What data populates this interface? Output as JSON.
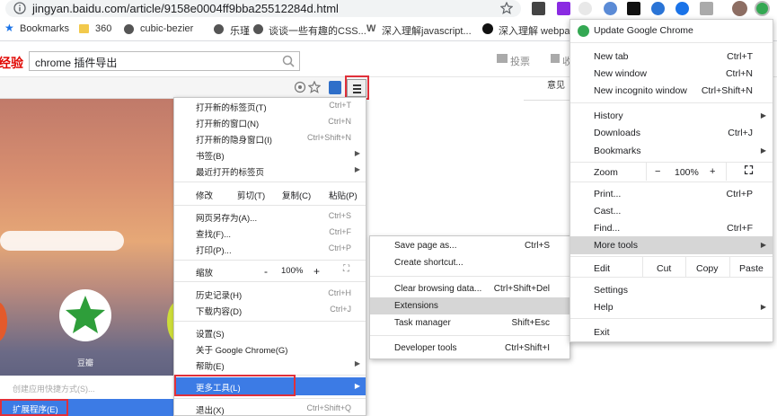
{
  "url": "jingyan.baidu.com/article/9158e0004ff9bba25512284d.html",
  "bookmarks": [
    {
      "label": "Bookmarks"
    },
    {
      "label": "360"
    },
    {
      "label": "cubic-bezier"
    },
    {
      "label": "乐瑾"
    },
    {
      "label": "谈谈一些有趣的CSS..."
    },
    {
      "label": "深入理解javascript..."
    },
    {
      "label": "深入理解 webpac"
    }
  ],
  "baidu": {
    "logo": "经验",
    "search_value": "chrome 插件导出",
    "vote": "投票",
    "close": "收",
    "feedback": "意见"
  },
  "newtab": {
    "tile_label": "豆瓣",
    "create_shortcut": "创建应用快捷方式(S)...",
    "extensions": "扩展程序(E)"
  },
  "cmenu": {
    "items": [
      {
        "label": "打开新的标签页(T)",
        "shortcut": "Ctrl+T"
      },
      {
        "label": "打开新的窗口(N)",
        "shortcut": "Ctrl+N"
      },
      {
        "label": "打开新的隐身窗口(I)",
        "shortcut": "Ctrl+Shift+N"
      },
      {
        "label": "书签(B)",
        "shortcut": ""
      },
      {
        "label": "最近打开的标签页",
        "shortcut": ""
      }
    ],
    "edit": {
      "label": "修改",
      "cut": "剪切(T)",
      "copy": "复制(C)",
      "paste": "粘贴(P)"
    },
    "items2": [
      {
        "label": "网页另存为(A)...",
        "shortcut": "Ctrl+S"
      },
      {
        "label": "查找(F)...",
        "shortcut": "Ctrl+F"
      },
      {
        "label": "打印(P)...",
        "shortcut": "Ctrl+P"
      }
    ],
    "zoom": {
      "label": "缩放",
      "minus": "-",
      "value": "100%",
      "plus": "+"
    },
    "items3": [
      {
        "label": "历史记录(H)",
        "shortcut": "Ctrl+H"
      },
      {
        "label": "下载内容(D)",
        "shortcut": "Ctrl+J"
      }
    ],
    "items4": [
      {
        "label": "设置(S)"
      },
      {
        "label": "关于 Google Chrome(G)"
      },
      {
        "label": "帮助(E)"
      }
    ],
    "more_tools": "更多工具(L)",
    "exit": {
      "label": "退出(X)",
      "shortcut": "Ctrl+Shift+Q"
    }
  },
  "csub": {
    "items": [
      {
        "label": "Save page as...",
        "shortcut": "Ctrl+S"
      },
      {
        "label": "Create shortcut...",
        "shortcut": ""
      },
      {
        "label": "Clear browsing data...",
        "shortcut": "Ctrl+Shift+Del"
      },
      {
        "label": "Extensions",
        "shortcut": ""
      },
      {
        "label": "Task manager",
        "shortcut": "Shift+Esc"
      },
      {
        "label": "Developer tools",
        "shortcut": "Ctrl+Shift+I"
      }
    ]
  },
  "mmenu": {
    "update": "Update Google Chrome",
    "items1": [
      {
        "label": "New tab",
        "shortcut": "Ctrl+T"
      },
      {
        "label": "New window",
        "shortcut": "Ctrl+N"
      },
      {
        "label": "New incognito window",
        "shortcut": "Ctrl+Shift+N"
      }
    ],
    "items2": [
      {
        "label": "History",
        "shortcut": ""
      },
      {
        "label": "Downloads",
        "shortcut": "Ctrl+J"
      },
      {
        "label": "Bookmarks",
        "shortcut": ""
      }
    ],
    "zoom": {
      "label": "Zoom",
      "minus": "−",
      "value": "100%",
      "plus": "+"
    },
    "items3": [
      {
        "label": "Print...",
        "shortcut": "Ctrl+P"
      },
      {
        "label": "Cast...",
        "shortcut": ""
      },
      {
        "label": "Find...",
        "shortcut": "Ctrl+F"
      },
      {
        "label": "More tools",
        "shortcut": ""
      }
    ],
    "edit": {
      "label": "Edit",
      "cut": "Cut",
      "copy": "Copy",
      "paste": "Paste"
    },
    "items4": [
      {
        "label": "Settings"
      },
      {
        "label": "Help"
      }
    ],
    "exit": "Exit"
  },
  "colors": {
    "highlight_blue": "#3c7be5",
    "red_box": "#e0303a",
    "submenu_hover": "#d6d6d6"
  }
}
